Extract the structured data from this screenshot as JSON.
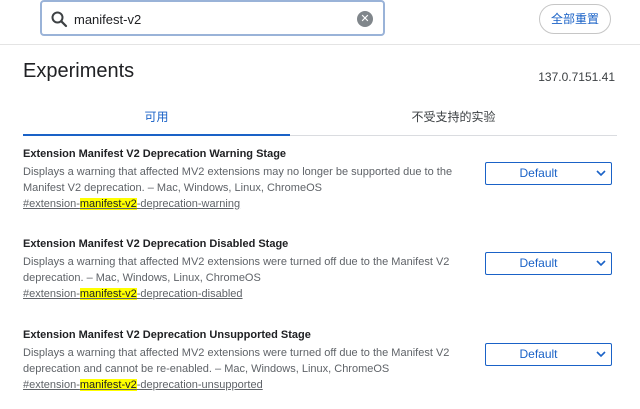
{
  "search": {
    "value": "manifest-v2",
    "clear_icon": "clear-icon",
    "search_icon": "search-icon"
  },
  "header": {
    "reset_label": "全部重置"
  },
  "page": {
    "title": "Experiments",
    "version": "137.0.7151.41"
  },
  "tabs": [
    {
      "label": "可用",
      "active": true
    },
    {
      "label": "不受支持的实验",
      "active": false
    }
  ],
  "experiments": [
    {
      "title": "Extension Manifest V2 Deprecation Warning Stage",
      "description": "Displays a warning that affected MV2 extensions may no longer be supported due to the Manifest V2 deprecation. – Mac, Windows, Linux, ChromeOS",
      "link_prefix": "#extension-",
      "link_highlight": "manifest-v2",
      "link_suffix": "-deprecation-warning",
      "select_value": "Default"
    },
    {
      "title": "Extension Manifest V2 Deprecation Disabled Stage",
      "description": "Displays a warning that affected MV2 extensions were turned off due to the Manifest V2 deprecation. – Mac, Windows, Linux, ChromeOS",
      "link_prefix": "#extension-",
      "link_highlight": "manifest-v2",
      "link_suffix": "-deprecation-disabled",
      "select_value": "Default"
    },
    {
      "title": "Extension Manifest V2 Deprecation Unsupported Stage",
      "description": "Displays a warning that affected MV2 extensions were turned off due to the Manifest V2 deprecation and cannot be re-enabled. – Mac, Windows, Linux, ChromeOS",
      "link_prefix": "#extension-",
      "link_highlight": "manifest-v2",
      "link_suffix": "-deprecation-unsupported",
      "select_value": "Default"
    }
  ],
  "colors": {
    "accent": "#1a62c7",
    "highlight": "#ffff00",
    "search_border": "#9ab3d8"
  }
}
